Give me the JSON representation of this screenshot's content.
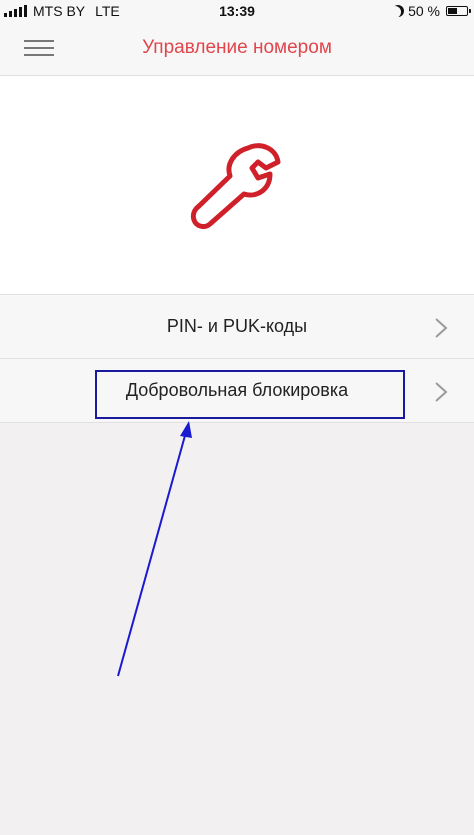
{
  "status_bar": {
    "carrier": "MTS BY",
    "network": "LTE",
    "time": "13:39",
    "battery_percent_label": "50 %",
    "battery_level": 0.5
  },
  "header": {
    "title": "Управление номером",
    "menu_icon": "hamburger-menu-icon"
  },
  "hero": {
    "icon": "wrench-icon"
  },
  "menu_items": [
    {
      "label": "PIN- и PUK-коды",
      "icon": "chevron-right-icon"
    },
    {
      "label": "Добровольная блокировка",
      "icon": "chevron-right-icon"
    }
  ],
  "annotation": {
    "highlight_color": "#1a1a9c",
    "arrow_color": "#1a1ad0"
  },
  "colors": {
    "accent": "#e0464c",
    "background": "#f2f0f1"
  }
}
